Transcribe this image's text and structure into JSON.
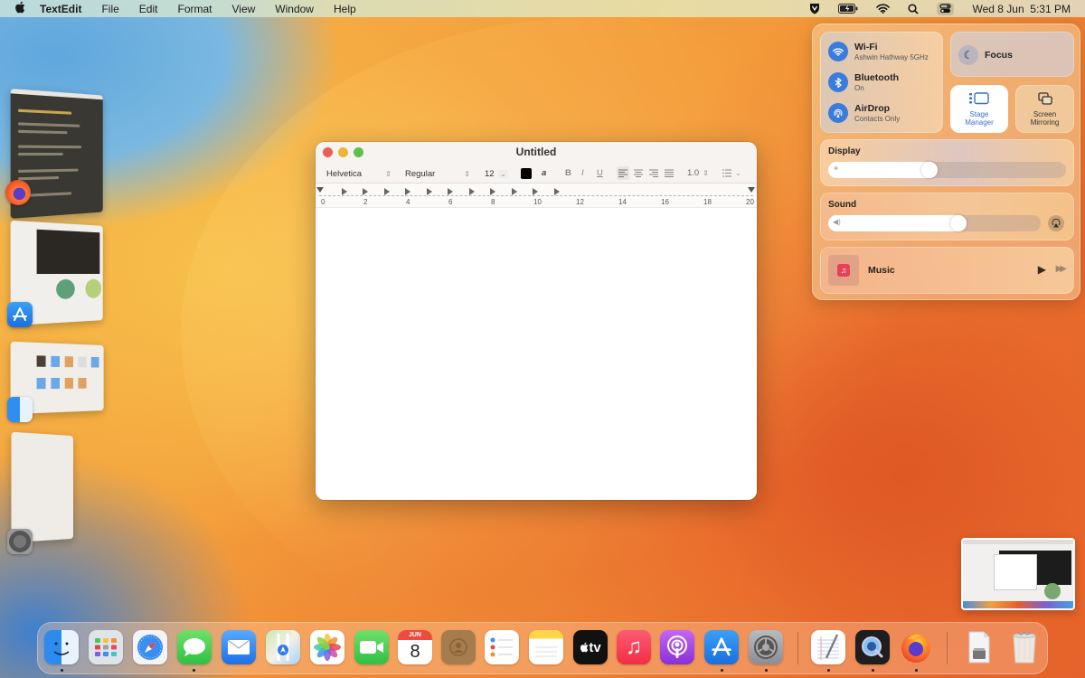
{
  "menubar": {
    "apple_icon": "",
    "app_name": "TextEdit",
    "menus": [
      "File",
      "Edit",
      "Format",
      "View",
      "Window",
      "Help"
    ],
    "status_icons": [
      "shield-icon",
      "battery-icon",
      "wifi-icon",
      "search-icon",
      "control-center-icon"
    ],
    "clock": "Wed 8 Jun  5:31 PM"
  },
  "control_center": {
    "wifi": {
      "title": "Wi-Fi",
      "subtitle": "Ashwin Hathway 5GHz"
    },
    "bluetooth": {
      "title": "Bluetooth",
      "subtitle": "On"
    },
    "airdrop": {
      "title": "AirDrop",
      "subtitle": "Contacts Only"
    },
    "focus": {
      "label": "Focus"
    },
    "stage_manager": {
      "label_line1": "Stage",
      "label_line2": "Manager",
      "active": true
    },
    "screen_mirroring": {
      "label_line1": "Screen",
      "label_line2": "Mirroring"
    },
    "display": {
      "label": "Display",
      "brightness_percent": 42
    },
    "sound": {
      "label": "Sound",
      "volume_percent": 62
    },
    "music": {
      "label": "Music",
      "play_icon": "▶",
      "forward_icon": "▶▶"
    }
  },
  "textedit": {
    "title": "Untitled",
    "font": "Helvetica",
    "style": "Regular",
    "size": "12",
    "text_color": "#000000",
    "bold": "B",
    "italic": "I",
    "underline": "U",
    "line_spacing": "1.0",
    "ruler_numbers": [
      "0",
      "2",
      "4",
      "6",
      "8",
      "10",
      "12",
      "14",
      "16",
      "18",
      "20"
    ],
    "document_text": ""
  },
  "stage_manager": {
    "apps": [
      "Firefox",
      "App Store",
      "Finder",
      "System Settings"
    ]
  },
  "dock": {
    "apps": [
      {
        "name": "Finder",
        "running": true
      },
      {
        "name": "Launchpad",
        "running": false
      },
      {
        "name": "Safari",
        "running": false
      },
      {
        "name": "Messages",
        "running": true
      },
      {
        "name": "Mail",
        "running": false
      },
      {
        "name": "Maps",
        "running": false
      },
      {
        "name": "Photos",
        "running": false
      },
      {
        "name": "FaceTime",
        "running": false
      },
      {
        "name": "Calendar",
        "running": false,
        "month": "JUN",
        "day": "8"
      },
      {
        "name": "Contacts",
        "running": false
      },
      {
        "name": "Reminders",
        "running": false
      },
      {
        "name": "Notes",
        "running": false
      },
      {
        "name": "Apple TV",
        "running": false,
        "label": "tv"
      },
      {
        "name": "Music",
        "running": false
      },
      {
        "name": "Podcasts",
        "running": false
      },
      {
        "name": "App Store",
        "running": true
      },
      {
        "name": "System Settings",
        "running": true
      },
      {
        "name": "TextEdit",
        "running": true
      },
      {
        "name": "QuickTime Player",
        "running": true
      },
      {
        "name": "Firefox",
        "running": true
      },
      {
        "name": "Downloads",
        "running": false
      },
      {
        "name": "Trash",
        "running": false
      }
    ]
  }
}
